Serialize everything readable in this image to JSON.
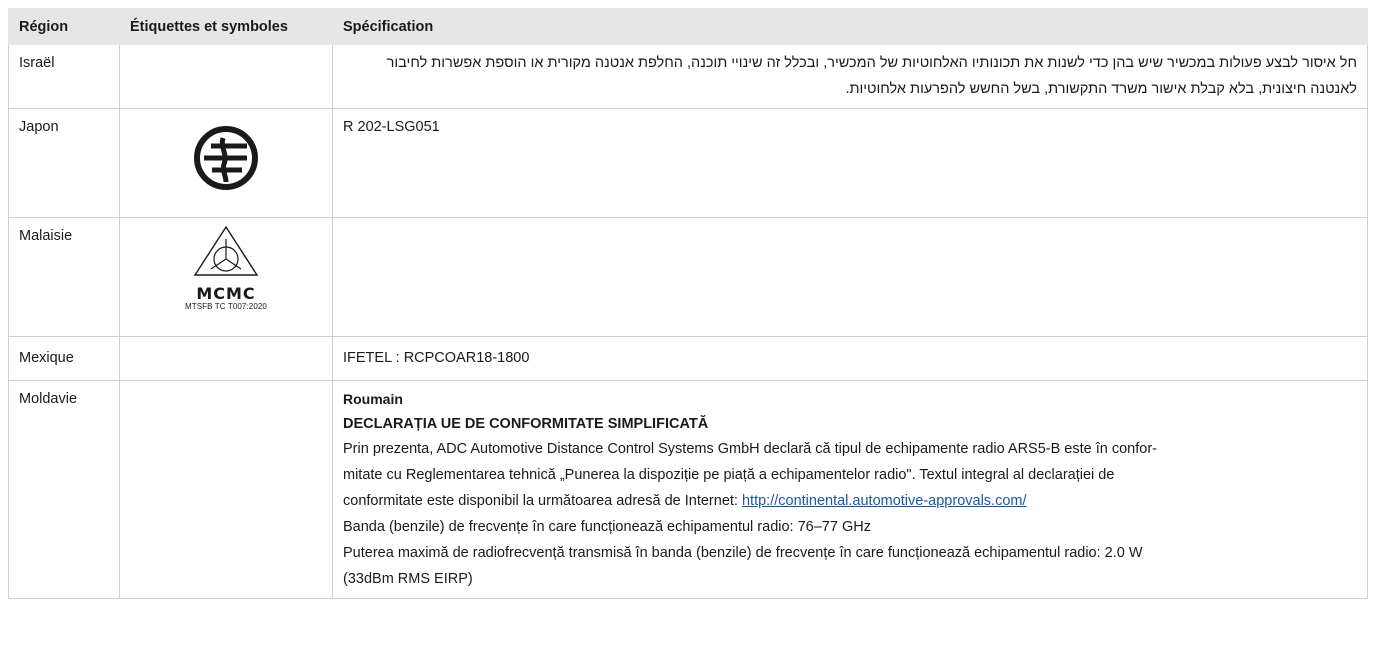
{
  "table": {
    "headers": [
      "Région",
      "Étiquettes et symboles",
      "Spécification"
    ],
    "rows": [
      {
        "region": "Israël",
        "spec": "חל איסור לבצע פעולות במכשיר שיש בהן כדי לשנות את תכונותיו האלחוטיות של המכשיר, ובכלל זה שינויי תוכנה, החלפת אנטנה מקורית או הוספת אפשרות לחיבור לאנטנה חיצונית, בלא קבלת אישור משרד התקשורת, בשל החשש להפרעות אלחוטיות."
      },
      {
        "region": "Japon",
        "symbol_icon": "japan-telec-mark-icon",
        "spec": "R 202-LSG051"
      },
      {
        "region": "Malaisie",
        "symbol_icon": "mcmc-mark-icon",
        "symbol_wordmark": "MCMC",
        "symbol_caption": "MTSFB TC T007:2020",
        "spec": ""
      },
      {
        "region": "Mexique",
        "spec": "IFETEL : RCPCOAR18-1800"
      },
      {
        "region": "Moldavie",
        "spec_language": "Roumain",
        "spec_title": "DECLARAȚIA UE DE CONFORMITATE SIMPLIFICATĂ",
        "spec_paragraph_1a": "Prin prezenta, ADC Automotive Distance Control Systems GmbH declară că tipul de echipamente radio ARS5-B este în confor-",
        "spec_paragraph_1b": "mitate cu Reglementarea tehnică „Punerea la dispoziție pe piață a echipamentelor radio\". Textul integral al declarației de",
        "spec_paragraph_1c": "conformitate este disponibil la următoarea adresă de Internet: ",
        "spec_link": "http://continental.automotive-approvals.com/",
        "spec_line_band": "Banda (benzile) de frecvențe în care funcționează echipamentul radio: 76–77 GHz",
        "spec_line_power_a": "Puterea maximă de radiofrecvență transmisă în banda (benzile) de frecvențe în care funcționează echipamentul radio: 2.0 W",
        "spec_line_power_b": "(33dBm RMS EIRP)"
      }
    ]
  }
}
